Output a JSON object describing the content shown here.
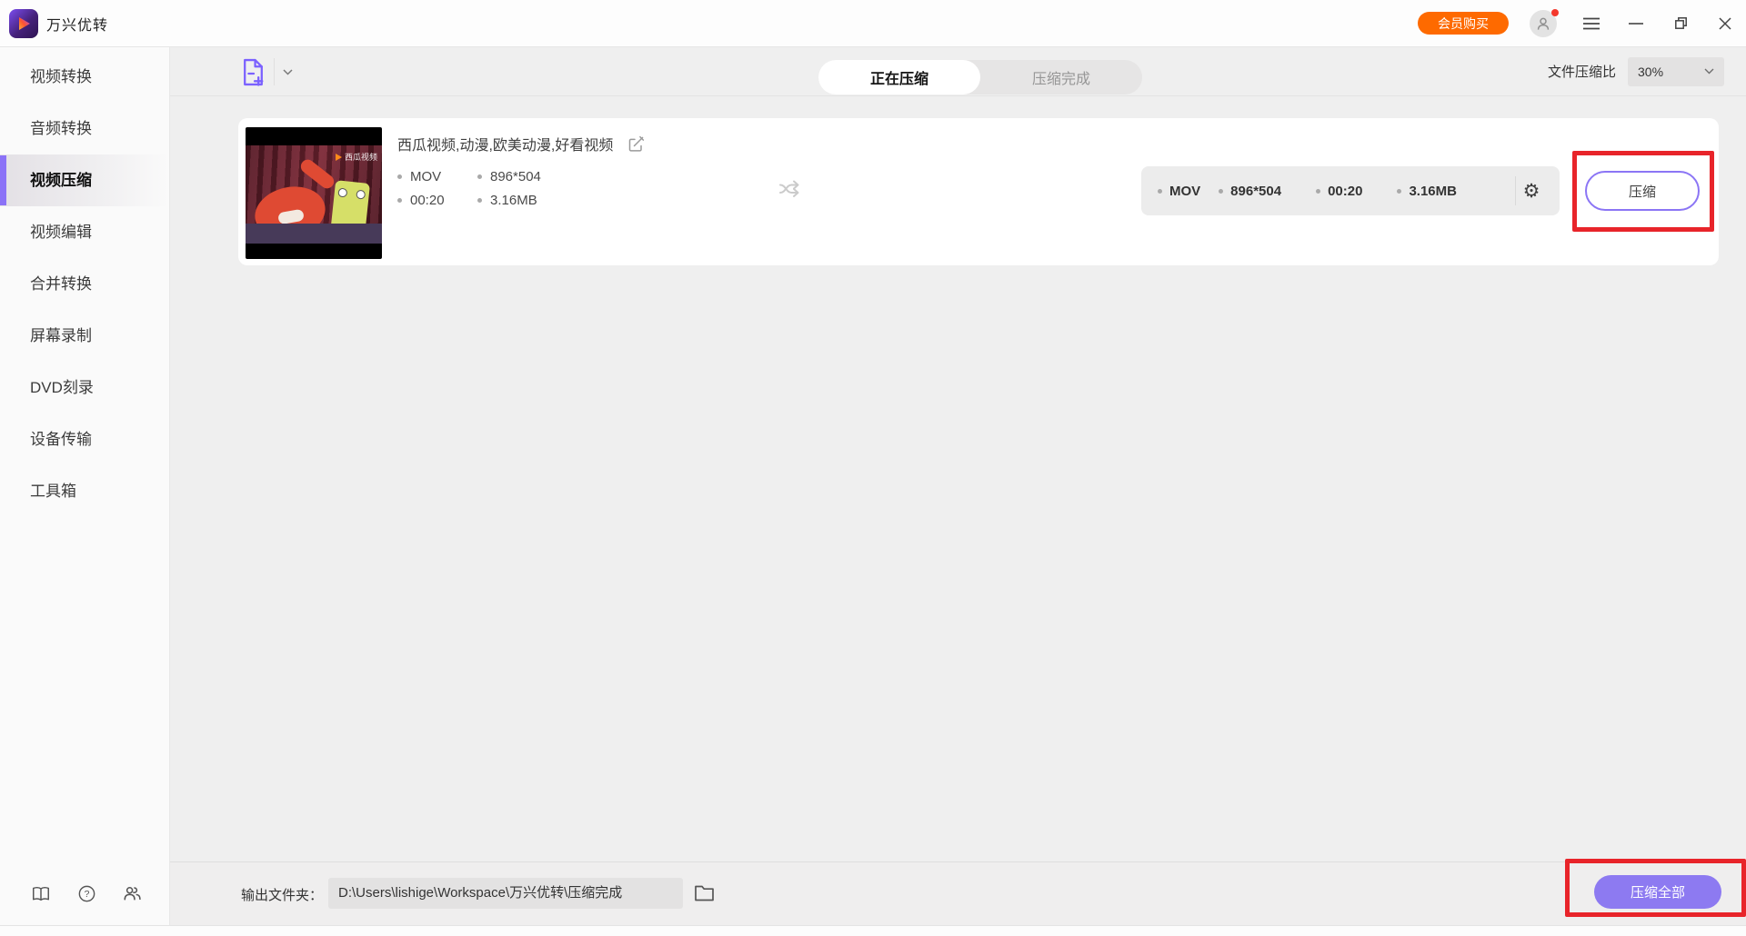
{
  "app_title": "万兴优转",
  "titlebar": {
    "buy_label": "会员购买"
  },
  "sidebar": {
    "items": [
      {
        "label": "视频转换",
        "active": false
      },
      {
        "label": "音频转换",
        "active": false
      },
      {
        "label": "视频压缩",
        "active": true
      },
      {
        "label": "视频编辑",
        "active": false
      },
      {
        "label": "合并转换",
        "active": false
      },
      {
        "label": "屏幕录制",
        "active": false
      },
      {
        "label": "DVD刻录",
        "active": false
      },
      {
        "label": "设备传输",
        "active": false
      },
      {
        "label": "工具箱",
        "active": false
      }
    ]
  },
  "header": {
    "tab_active": "正在压缩",
    "tab_inactive": "压缩完成",
    "ratio_label": "文件压缩比",
    "ratio_value": "30%"
  },
  "file": {
    "title": "西瓜视频,动漫,欧美动漫,好看视频",
    "watermark": "西瓜视频",
    "source": {
      "format": "MOV",
      "resolution": "896*504",
      "duration": "00:20",
      "size": "3.16MB"
    },
    "output": {
      "format": "MOV",
      "resolution": "896*504",
      "duration": "00:20",
      "size": "3.16MB"
    },
    "compress_label": "压缩"
  },
  "bottom": {
    "output_folder_label": "输出文件夹：",
    "output_path": "D:\\Users\\lishige\\Workspace\\万兴优转\\压缩完成",
    "compress_all_label": "压缩全部"
  },
  "icons": {
    "gear_glyph": "⚙"
  },
  "colors": {
    "accent_purple": "#8b75f5",
    "button_purple": "#8d7af1",
    "brand_orange": "#fe6a00",
    "annotation_red": "#e8242a"
  }
}
